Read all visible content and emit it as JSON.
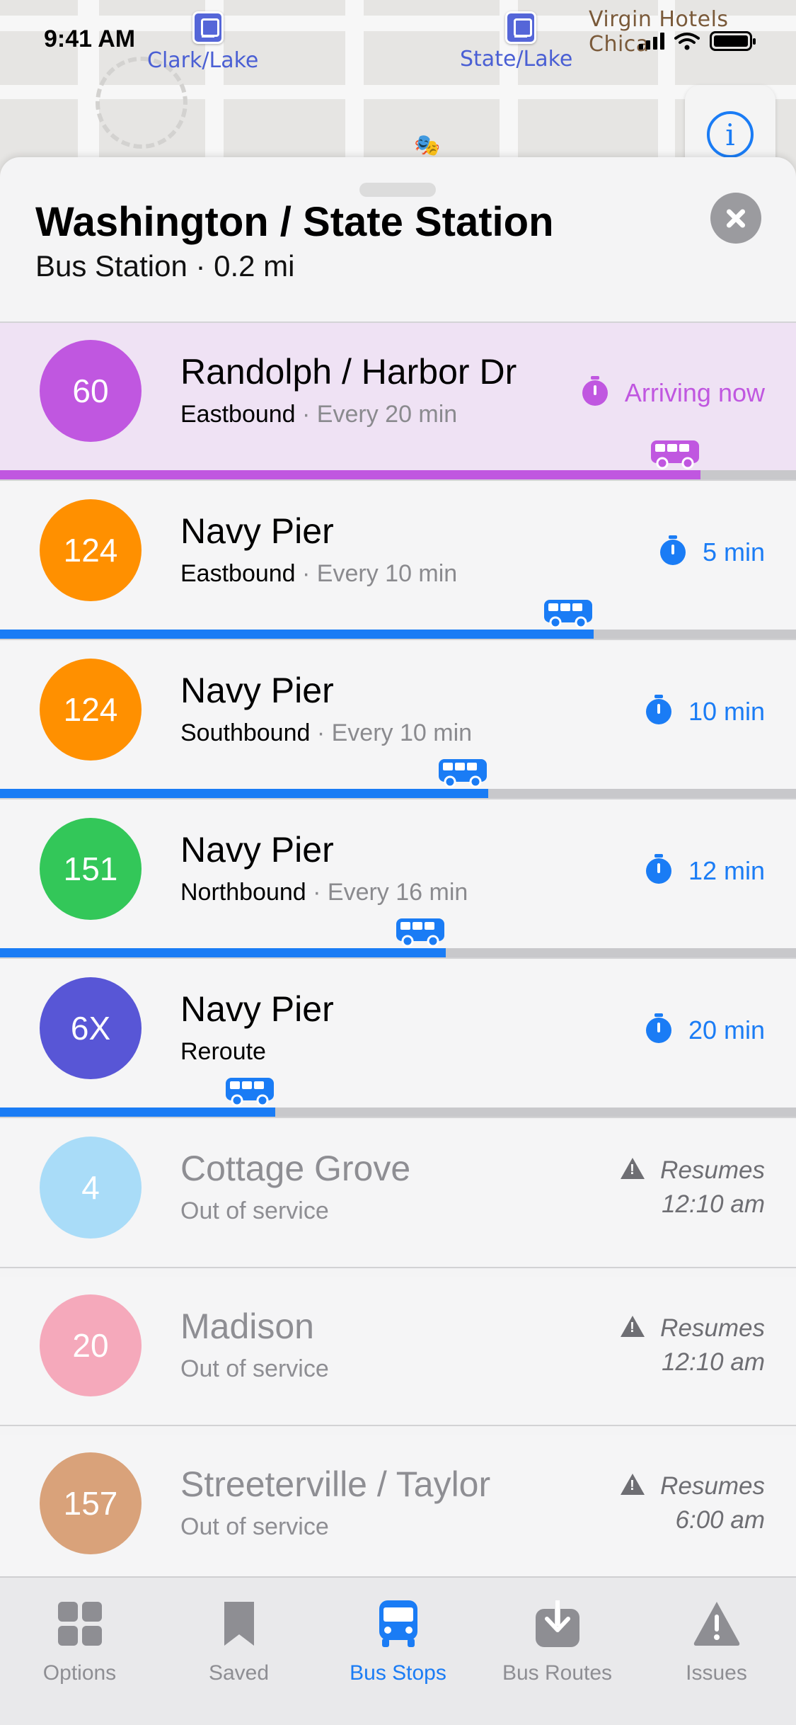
{
  "status_bar": {
    "time": "9:41 AM"
  },
  "map": {
    "labels": {
      "clark_lake": "Clark/Lake",
      "state_lake": "State/Lake",
      "virgin": "Virgin Hotels Chica"
    }
  },
  "station": {
    "title": "Washington / State Station",
    "subtitle": "Bus Station · 0.2 mi"
  },
  "routes": [
    {
      "number": "60",
      "name": "Randolph / Harbor Dr",
      "direction": "Eastbound",
      "frequency": " · Every 20 min",
      "eta": "Arriving now",
      "progress": 0.88,
      "color": "#c057e0",
      "eta_color": "#c057e0"
    },
    {
      "number": "124",
      "name": "Navy Pier",
      "direction": "Eastbound",
      "frequency": " · Every 10 min",
      "eta": "5 min",
      "progress": 0.746,
      "color": "#ff9000",
      "eta_color": "#1a7cf5"
    },
    {
      "number": "124",
      "name": "Navy Pier",
      "direction": "Southbound",
      "frequency": " · Every 10 min",
      "eta": "10 min",
      "progress": 0.613,
      "color": "#ff9000",
      "eta_color": "#1a7cf5"
    },
    {
      "number": "151",
      "name": "Navy Pier",
      "direction": "Northbound",
      "frequency": " · Every 16 min",
      "eta": "12 min",
      "progress": 0.56,
      "color": "#33c759",
      "eta_color": "#1a7cf5"
    },
    {
      "number": "6X",
      "name": "Navy Pier",
      "direction": "Reroute",
      "frequency": "",
      "eta": "20 min",
      "progress": 0.346,
      "color": "#5856d6",
      "eta_color": "#1a7cf5"
    }
  ],
  "out_of_service": [
    {
      "number": "4",
      "name": "Cottage Grove",
      "status": "Out of service",
      "resume_1": "Resumes",
      "resume_2": "12:10 am",
      "color": "#a9dcf8"
    },
    {
      "number": "20",
      "name": "Madison",
      "status": "Out of service",
      "resume_1": "Resumes",
      "resume_2": "12:10 am",
      "color": "#f5a9bb"
    },
    {
      "number": "157",
      "name": "Streeterville / Taylor",
      "status": "Out of service",
      "resume_1": "Resumes",
      "resume_2": "6:00 am",
      "color": "#d9a27a"
    }
  ],
  "tabs": [
    {
      "label": "Options",
      "icon": "grid-icon"
    },
    {
      "label": "Saved",
      "icon": "bookmark-icon"
    },
    {
      "label": "Bus Stops",
      "icon": "bus-icon"
    },
    {
      "label": "Bus Routes",
      "icon": "download-icon"
    },
    {
      "label": "Issues",
      "icon": "warning-icon"
    }
  ],
  "colors": {
    "accent": "#1a7cf5",
    "track": "#c8c8cb",
    "highlight": "#efe2f4"
  }
}
